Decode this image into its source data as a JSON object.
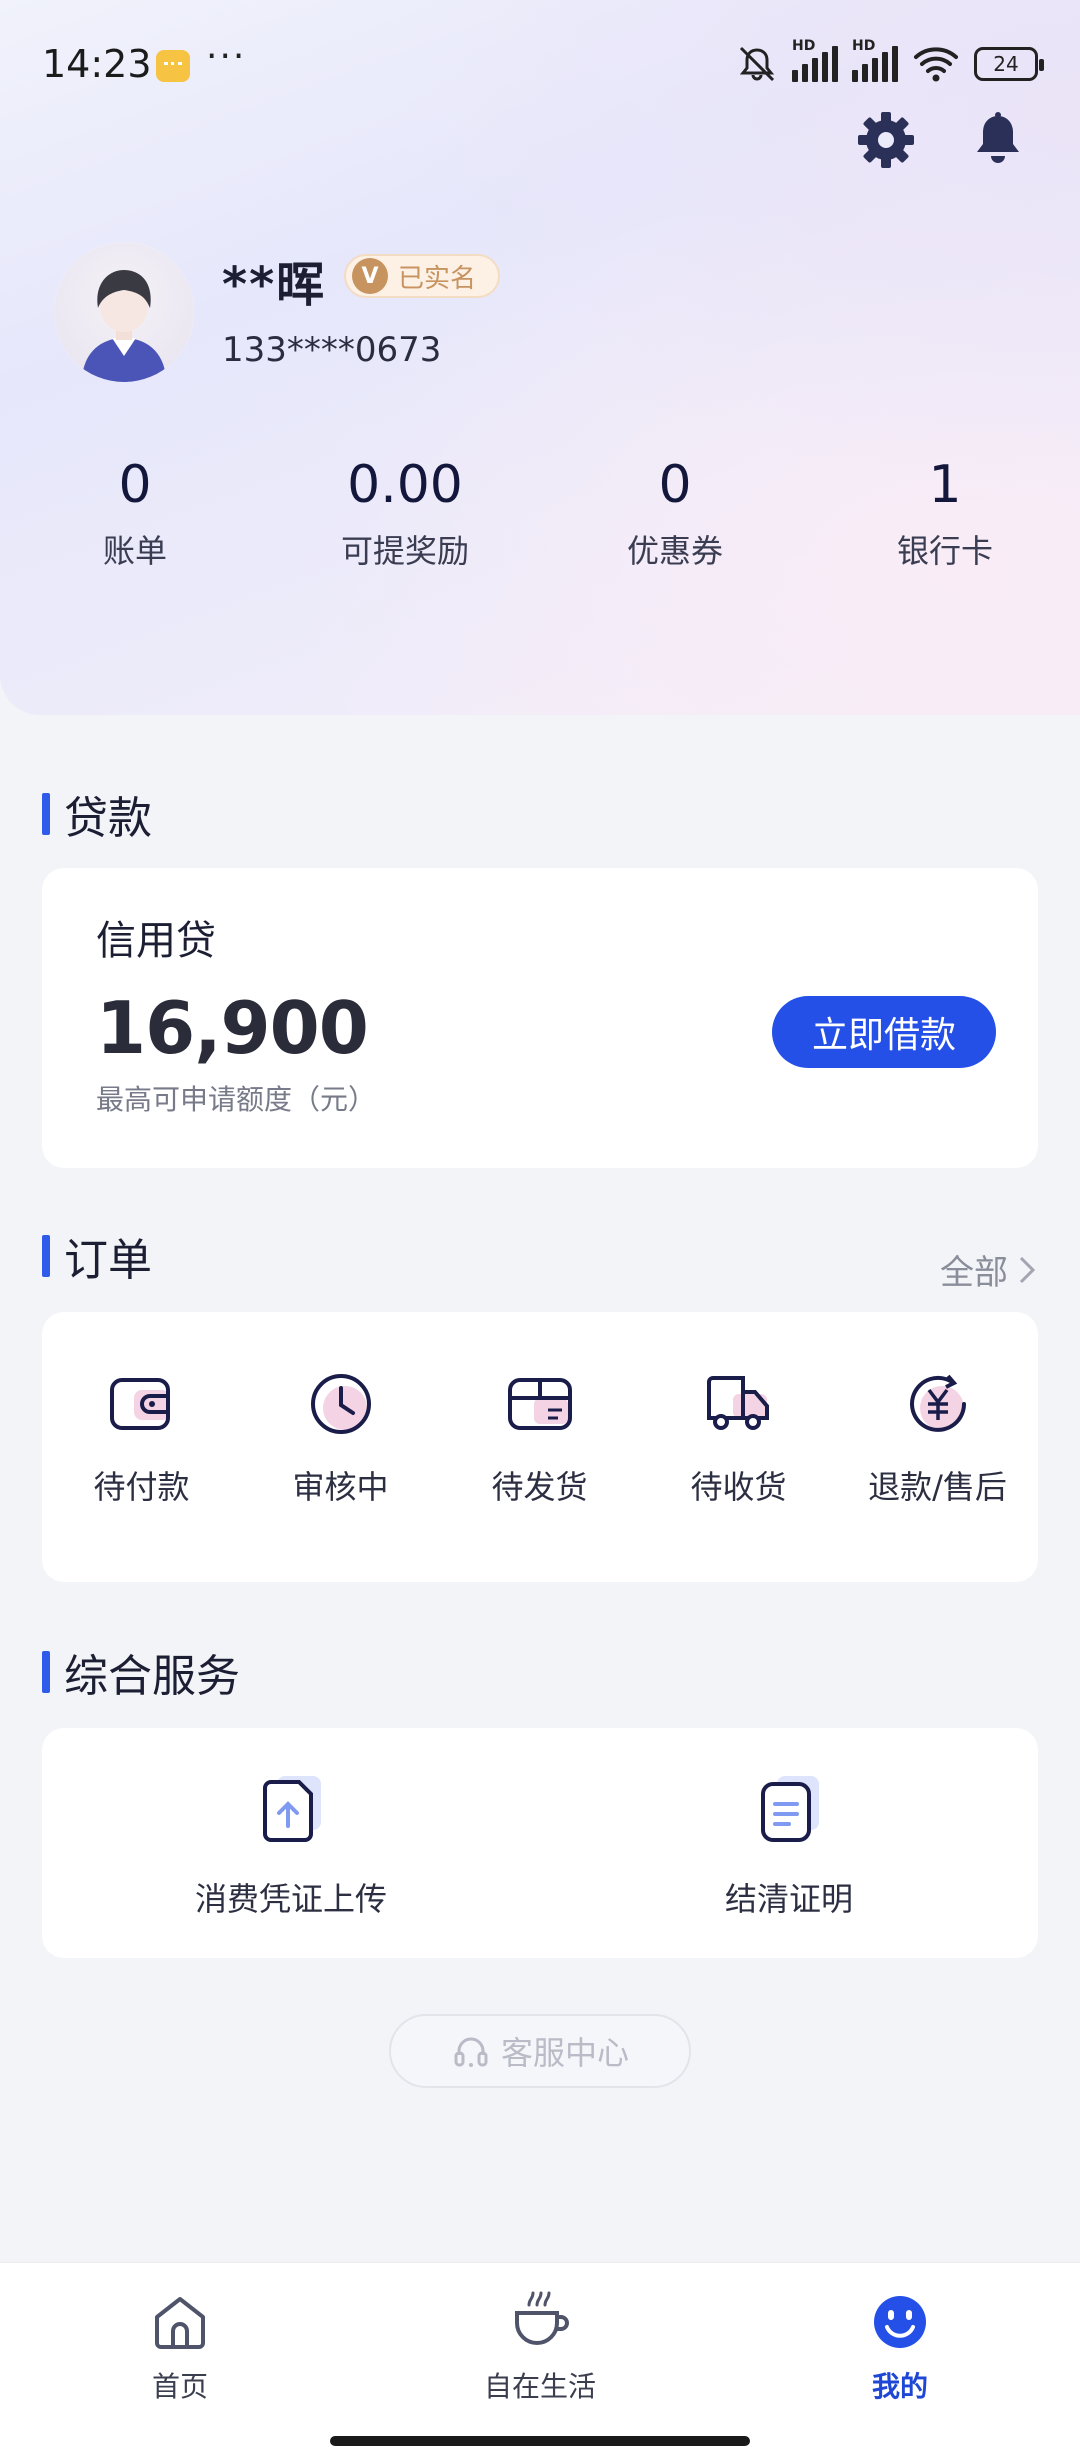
{
  "status_bar": {
    "time": "14:23",
    "dots": "···",
    "hd1": "HD",
    "hd2": "HD",
    "battery": "24"
  },
  "profile": {
    "name": "**晖",
    "verified_badge": "V",
    "verified_label": "已实名",
    "phone": "133****0673"
  },
  "stats": [
    {
      "value": "0",
      "label": "账单"
    },
    {
      "value": "0.00",
      "label": "可提奖励"
    },
    {
      "value": "0",
      "label": "优惠券"
    },
    {
      "value": "1",
      "label": "银行卡"
    }
  ],
  "loan": {
    "section_title": "贷款",
    "product_name": "信用贷",
    "amount": "16,900",
    "amount_caption": "最高可申请额度（元）",
    "button_label": "立即借款"
  },
  "orders": {
    "section_title": "订单",
    "all_label": "全部",
    "items": [
      {
        "label": "待付款",
        "icon": "wallet-icon"
      },
      {
        "label": "审核中",
        "icon": "clock-icon"
      },
      {
        "label": "待发货",
        "icon": "package-icon"
      },
      {
        "label": "待收货",
        "icon": "truck-icon"
      },
      {
        "label": "退款/售后",
        "icon": "refund-icon"
      }
    ]
  },
  "services": {
    "section_title": "综合服务",
    "items": [
      {
        "label": "消费凭证上传",
        "icon": "upload-document-icon"
      },
      {
        "label": "结清证明",
        "icon": "certificate-document-icon"
      }
    ]
  },
  "customer_service": {
    "label": "客服中心"
  },
  "tabbar": {
    "items": [
      {
        "label": "首页",
        "icon": "home-icon",
        "active": false
      },
      {
        "label": "自在生活",
        "icon": "coffee-cup-icon",
        "active": false
      },
      {
        "label": "我的",
        "icon": "smiley-icon",
        "active": true
      }
    ]
  },
  "colors": {
    "accent": "#2550e8",
    "section_bar": "#2f5bea",
    "verified": "#c7935f"
  }
}
